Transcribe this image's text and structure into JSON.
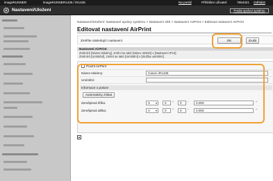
{
  "topbar": {
    "product": "imageRUNNER",
    "model": "imageRUNNER1435 / iR1435",
    "portal_link": "Na portál",
    "user_label": "Přihlášen uživatel:",
    "user_id": "7654321",
    "logout": "Odhlásit"
  },
  "header": {
    "title": "Nastavení/Uložení",
    "portal_button": "Poslat správci systému"
  },
  "sidebar": {
    "items": [
      "Nástroj",
      "Ovládání hesla",
      "Ovládání tiskové úlohy",
      "Nastavení ovladače",
      "Nastavení tiskárny",
      "Nastavení sítě",
      "Nastavení kopírování",
      "Nastavení tisku",
      "Nastavení zabezpečení",
      "Nastavení zabezpečení",
      "Nastavení úlohy",
      "Nastavení správy systému",
      "Nastavení systému",
      "Nastavení obsahu",
      "Nastavení systému",
      "Nastavení zabezpečení"
    ]
  },
  "main": {
    "breadcrumb": "Nastavení/Uložení: Nastavení správy systému > Nastavení sítě > Nastavení AirPrint > Editovat nastavení AirPrint",
    "title": "Editovat nastavení AirPrint",
    "apply_label": "Změňte následující nastavení.",
    "ok_button": "OK",
    "cancel_button": "Zrušit",
    "section_title": "Nastavení AirPrint",
    "note_line1": "Změnit-li [Název tiskárny], změní se také [Název mDNS] v [Nastavení IPv4].",
    "note_line2": "Změnit-li [Umístění], změní se také [Umístění] v [Služba umístění].",
    "use_airprint_label": "Použít AirPrint",
    "printer_name_label": "Název tiskárny:",
    "printer_name_value": "Canon iR1435",
    "location_label": "Umístění:",
    "location_value": "",
    "position_heading": "Informace o poloze",
    "auto_button": "Automaticky získat",
    "latitude_label": "Zeměpisná šířka:",
    "latitude_dir": "S",
    "latitude_deg": "0",
    "latitude_min": "0",
    "latitude_sec": "0.000",
    "longitude_label": "Zeměpisná délka:",
    "longitude_dir": "V",
    "longitude_deg": "0",
    "longitude_min": "0",
    "longitude_sec": "0.000",
    "deg_unit": "°",
    "min_unit": "'",
    "sec_unit": "\""
  },
  "colors": {
    "highlight": "#f0a032",
    "header_bg": "#2f2f2f",
    "sidebar_bg": "#c8c8c8"
  }
}
